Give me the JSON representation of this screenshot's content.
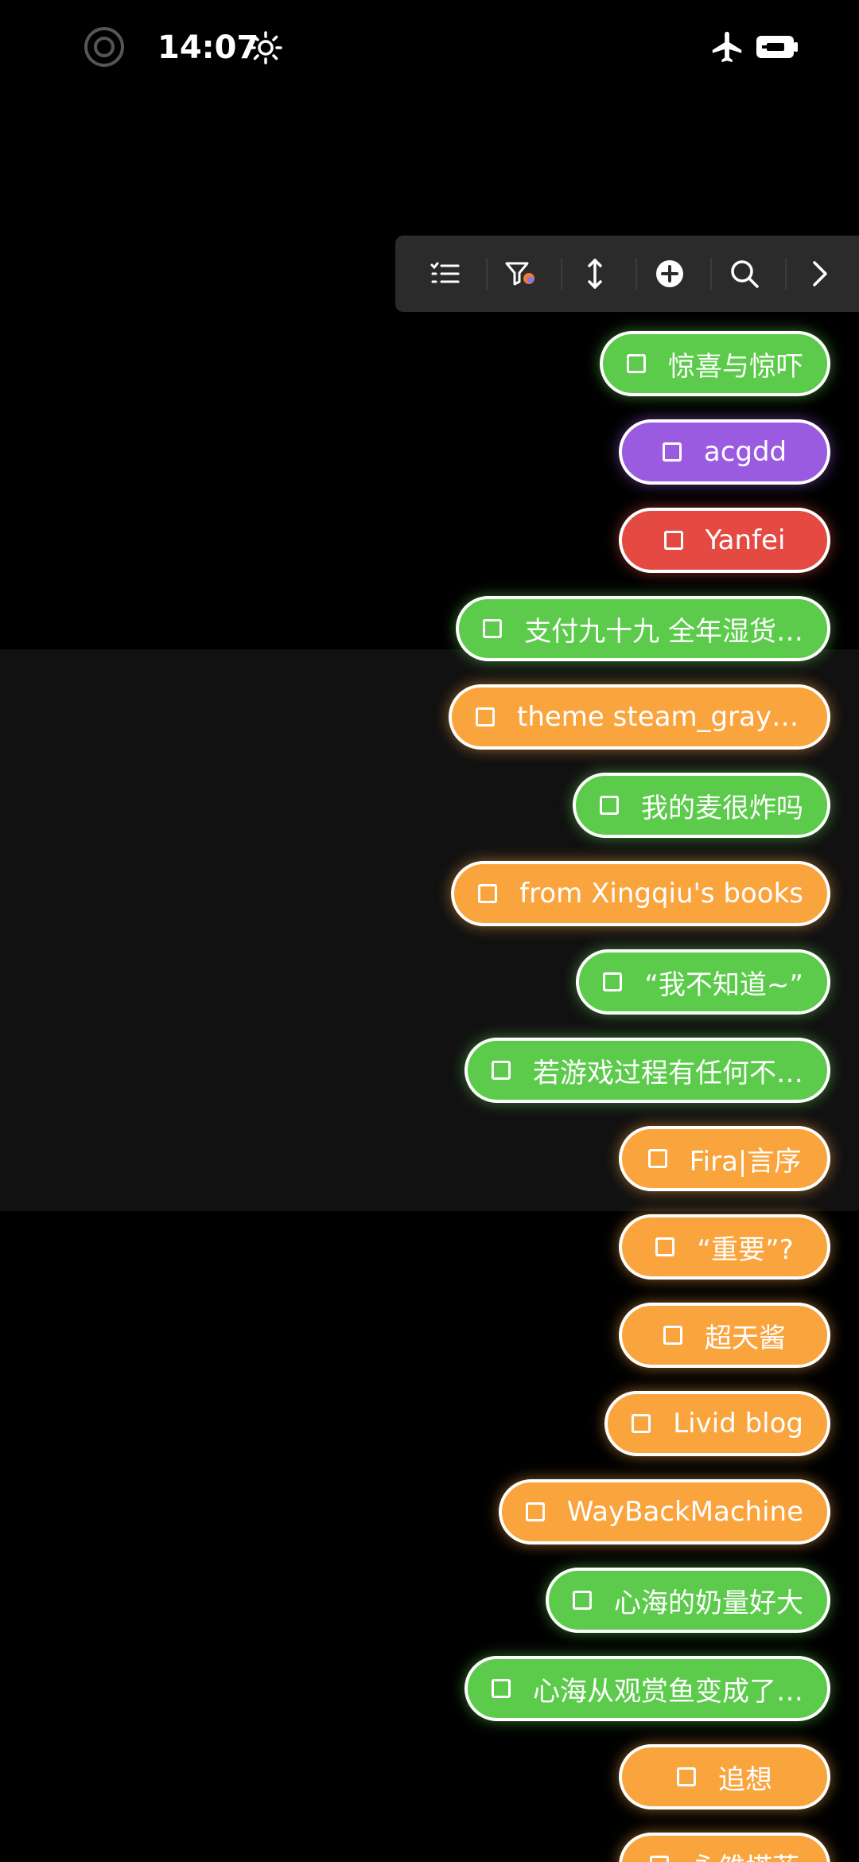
{
  "status_bar": {
    "time": "14:07",
    "icons": [
      "screen-record-icon",
      "brightness-icon",
      "airplane-mode-icon",
      "battery-charging-icon"
    ]
  },
  "toolbar": {
    "buttons": [
      {
        "name": "list-view",
        "icon": "list-icon"
      },
      {
        "name": "filter",
        "icon": "filter-icon"
      },
      {
        "name": "sort",
        "icon": "sort-arrows-icon"
      },
      {
        "name": "add",
        "icon": "plus-circle-icon"
      },
      {
        "name": "search",
        "icon": "search-icon"
      },
      {
        "name": "expand",
        "icon": "chevron-right-icon"
      }
    ]
  },
  "colors": {
    "green": "#5ccb4b",
    "purple": "#9b5be0",
    "red": "#e44a42",
    "orange": "#faa43e",
    "toolbar_bg": "#2b2b2b"
  },
  "tags": [
    {
      "label": "惊喜与惊吓",
      "color": "green"
    },
    {
      "label": "acgdd",
      "color": "purple"
    },
    {
      "label": "Yanfei",
      "color": "red"
    },
    {
      "label": "支付九十九 全年湿货…",
      "color": "green"
    },
    {
      "label": "theme  steam_grays…",
      "color": "orange"
    },
    {
      "label": "我的麦很炸吗",
      "color": "green"
    },
    {
      "label": "from Xingqiu's books",
      "color": "orange"
    },
    {
      "label": "“我不知道~”",
      "color": "green"
    },
    {
      "label": "若游戏过程有任何不…",
      "color": "green"
    },
    {
      "label": "Fira|言序",
      "color": "orange"
    },
    {
      "label": "“重要”?",
      "color": "orange"
    },
    {
      "label": "超天酱",
      "color": "orange"
    },
    {
      "label": "Livid  blog",
      "color": "orange"
    },
    {
      "label": "WayBackMachine",
      "color": "orange"
    },
    {
      "label": "心海的奶量好大",
      "color": "green"
    },
    {
      "label": "心海从观赏鱼变成了…",
      "color": "green"
    },
    {
      "label": "追想",
      "color": "orange"
    },
    {
      "label": "永雏塔菲",
      "color": "orange"
    }
  ]
}
